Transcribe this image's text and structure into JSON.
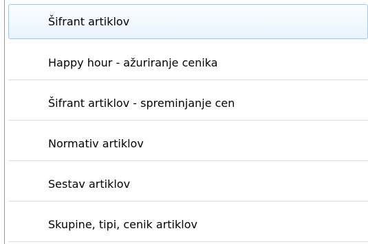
{
  "menu": {
    "items": [
      {
        "label": "Šifrant artiklov",
        "selected": true
      },
      {
        "label": "Happy hour - ažuriranje cenika",
        "selected": false
      },
      {
        "label": "Šifrant artiklov - spreminjanje cen",
        "selected": false
      },
      {
        "label": "Normativ artiklov",
        "selected": false
      },
      {
        "label": "Sestav artiklov",
        "selected": false
      },
      {
        "label": "Skupine, tipi, cenik artiklov",
        "selected": false
      }
    ]
  },
  "colors": {
    "selection_border": "#a6c6e6",
    "selection_fill": "#e9f3fc",
    "separator": "#dcdcdc"
  }
}
